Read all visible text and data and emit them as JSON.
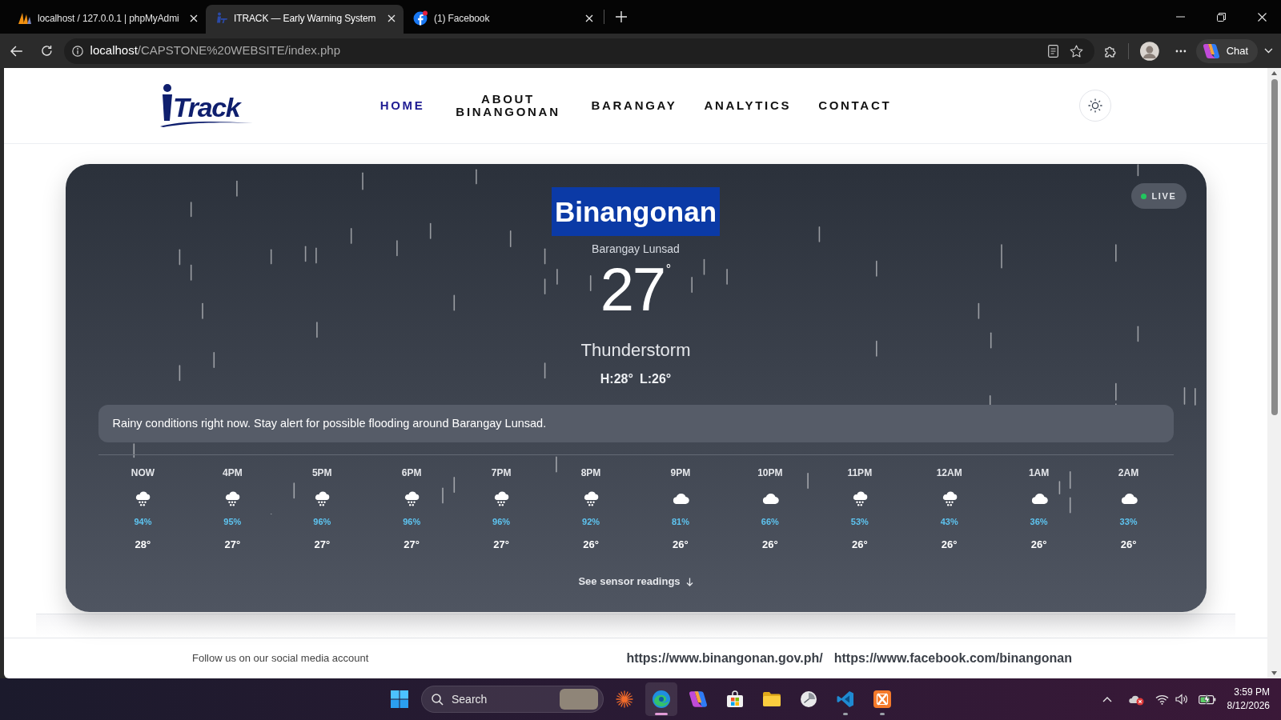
{
  "browser": {
    "tabs": [
      {
        "kind": "database",
        "title": "localhost / 127.0.0.1 | phpMyAdmi",
        "selected": false
      },
      {
        "kind": "site",
        "title": "ITRACK — Early Warning System",
        "selected": true
      },
      {
        "kind": "social",
        "title": "(1) Facebook",
        "selected": false
      }
    ],
    "address": {
      "host": "localhost",
      "path": "/CAPSTONE%20WEBSITE/index.php"
    },
    "chat_button": "Chat"
  },
  "header": {
    "logo": "Track",
    "nav": [
      {
        "label": "HOME",
        "selected": true
      },
      {
        "label": "ABOUT BINANGONAN",
        "selected": false
      },
      {
        "label": "BARANGAY",
        "selected": false
      },
      {
        "label": "ANALYTICS",
        "selected": false
      },
      {
        "label": "CONTACT",
        "selected": false
      }
    ]
  },
  "weather": {
    "live": "LIVE",
    "location": {
      "text": "Binangonan",
      "highlighted": true
    },
    "barangay": "Barangay Lunsad",
    "temperature": "27",
    "degree": "°",
    "condition": "Thunderstorm",
    "high": "H:28°",
    "low": "L:26°",
    "alert": "Rainy conditions right now. Stay alert for possible flooding around Barangay Lunsad.",
    "hourly": [
      {
        "time": "NOW",
        "kind": "rain",
        "chance": "94%",
        "temp": "28°"
      },
      {
        "time": "4PM",
        "kind": "rain",
        "chance": "95%",
        "temp": "27°"
      },
      {
        "time": "5PM",
        "kind": "rain",
        "chance": "96%",
        "temp": "27°"
      },
      {
        "time": "6PM",
        "kind": "rain",
        "chance": "96%",
        "temp": "27°"
      },
      {
        "time": "7PM",
        "kind": "rain",
        "chance": "96%",
        "temp": "27°"
      },
      {
        "time": "8PM",
        "kind": "rain",
        "chance": "92%",
        "temp": "26°"
      },
      {
        "time": "9PM",
        "kind": "cloud",
        "chance": "81%",
        "temp": "26°"
      },
      {
        "time": "10PM",
        "kind": "cloud",
        "chance": "66%",
        "temp": "26°"
      },
      {
        "time": "11PM",
        "kind": "rain",
        "chance": "53%",
        "temp": "26°"
      },
      {
        "time": "12AM",
        "kind": "rain",
        "chance": "43%",
        "temp": "26°"
      },
      {
        "time": "1AM",
        "kind": "cloud",
        "chance": "36%",
        "temp": "26°"
      },
      {
        "time": "2AM",
        "kind": "cloud",
        "chance": "33%",
        "temp": "26°"
      }
    ],
    "sensor_link": "See sensor readings"
  },
  "footer": {
    "text": "Follow us on our social media account",
    "links": [
      "https://www.binangonan.gov.ph/",
      "https://www.facebook.com/binangonan"
    ]
  },
  "taskbar": {
    "search": "Search",
    "apps": [
      {
        "kind": "sparkle",
        "open": false,
        "focused": false
      },
      {
        "kind": "swirl",
        "open": true,
        "focused": true
      },
      {
        "kind": "ribbon",
        "open": false,
        "focused": false
      },
      {
        "kind": "bag",
        "open": false,
        "focused": false
      },
      {
        "kind": "folder",
        "open": false,
        "focused": false
      },
      {
        "kind": "clock",
        "open": false,
        "focused": false
      },
      {
        "kind": "angle",
        "open": true,
        "focused": false
      },
      {
        "kind": "xsquare",
        "open": true,
        "focused": false
      }
    ],
    "time": "3:59 PM",
    "date": "8/12/2026"
  }
}
